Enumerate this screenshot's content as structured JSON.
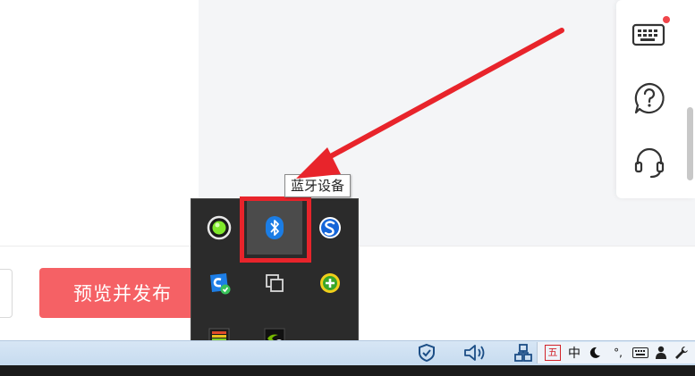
{
  "page": {
    "publish_button_label": "预览并发布"
  },
  "side_toolbar": {
    "icons": [
      "keyboard-icon",
      "help-question-icon",
      "customer-service-headset-icon"
    ],
    "badge_color": "#f0454a"
  },
  "tooltip": {
    "text": "蓝牙设备"
  },
  "tray_popup": {
    "icons": [
      "green-status-orb-icon",
      "bluetooth-icon",
      "sogou-input-icon",
      "tencent-pc-manager-icon",
      "copy-clipboard-icon",
      "green-plus-security-icon",
      "audio-equalizer-icon",
      "nvidia-update-icon"
    ],
    "active_item": "bluetooth-icon",
    "highlight_color": "#e8242b"
  },
  "taskbar": {
    "icons": [
      "shield-check-icon",
      "speaker-volume-icon",
      "network-icon"
    ],
    "ime": {
      "mode_glyph": "五",
      "language": "中",
      "punct": "°,",
      "icons": [
        "half-moon-icon",
        "keyboard-icon",
        "user-icon",
        "wrench-icon"
      ]
    }
  },
  "colors": {
    "accent": "#f56165",
    "arrow": "#e8242b",
    "bluetooth": "#1b7de5"
  }
}
